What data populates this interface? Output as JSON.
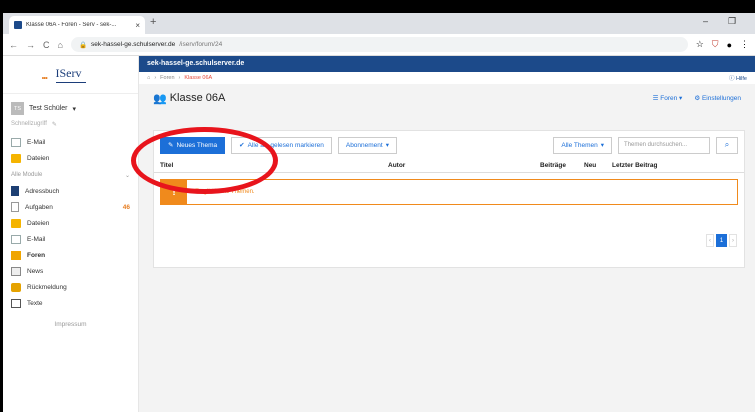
{
  "browser": {
    "tab_title": "Klasse 06A - Foren - Serv - sek-...",
    "tab_close": "×",
    "new_tab": "+",
    "win_min": "–",
    "win_max": "❐",
    "url_host": "sek-hassel-ge.schulserver.de",
    "url_path": "/iserv/forum/24",
    "nav_back": "←",
    "nav_forward": "→",
    "nav_reload": "C",
    "nav_home": "⌂",
    "star": "☆",
    "shield": "⛉",
    "menu": "⋮"
  },
  "sidebar": {
    "logo_text": "IServ",
    "user_initials": "TS",
    "user_name": "Test Schüler",
    "notepad": "Schnellzugriff",
    "quick": [
      "E-Mail",
      "Dateien"
    ],
    "modules_header": "Alle Module",
    "modules": [
      {
        "label": "Adressbuch",
        "icon": "book-icon"
      },
      {
        "label": "Aufgaben",
        "icon": "task-icon",
        "badge": "46"
      },
      {
        "label": "Dateien",
        "icon": "folder-icon"
      },
      {
        "label": "E-Mail",
        "icon": "mail-icon"
      },
      {
        "label": "Foren",
        "icon": "forum-icon",
        "active": true
      },
      {
        "label": "News",
        "icon": "news-icon"
      },
      {
        "label": "Rückmeldung",
        "icon": "feedback-icon"
      },
      {
        "label": "Texte",
        "icon": "text-icon"
      }
    ],
    "impressum": "Impressum"
  },
  "main": {
    "server": "sek-hassel-ge.schulserver.de",
    "breadcrumb": [
      "Foren",
      "Klasse 06A"
    ],
    "help": "Hilfe",
    "title": "Klasse 06A",
    "foren_btn": "Foren",
    "settings_btn": "Einstellungen",
    "new_topic": "Neues Thema",
    "mark_read": "Alle als gelesen markieren",
    "subscription": "Abonnement",
    "all_topics": "Alle Themen",
    "search_placeholder": "Themen durchsuchen...",
    "columns": [
      "Titel",
      "Autor",
      "Beiträge",
      "Neu",
      "Letzter Beitrag"
    ],
    "empty": "Es gibt keine Themen.",
    "page": "1"
  },
  "colors": {
    "brand": "#1c4a8a",
    "accent": "#1c6fd8",
    "warning": "#f08a1c",
    "highlight": "#e8141c"
  }
}
